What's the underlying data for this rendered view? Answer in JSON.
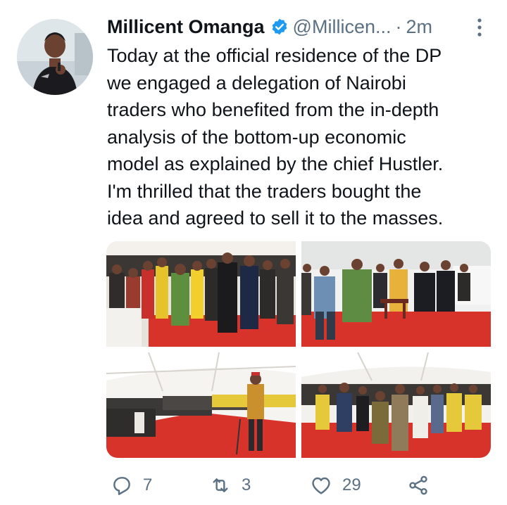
{
  "tweet": {
    "author_name": "Millicent Omanga",
    "author_handle": "@Millicen...",
    "separator": "·",
    "timestamp": "2m",
    "lines": [
      "Today at the official residence of the DP",
      "we engaged a delegation of Nairobi",
      "traders who benefited from the in-depth",
      "analysis of the bottom-up economic",
      "model as explained by the chief Hustler.",
      "I'm thrilled that the traders bought the",
      "idea and agreed to sell it to the masses."
    ]
  },
  "icons": {
    "verified": "verified-badge-icon",
    "more": "more-vertical-icon",
    "reply": "reply-icon",
    "retweet": "retweet-icon",
    "like": "like-icon",
    "share": "share-icon"
  },
  "actions": {
    "replies": "7",
    "retweets": "3",
    "likes": "29"
  },
  "colors": {
    "text": "#0f1419",
    "secondary": "#5b7083",
    "verified": "#1d9bf0",
    "carpet": "#d8332b"
  }
}
